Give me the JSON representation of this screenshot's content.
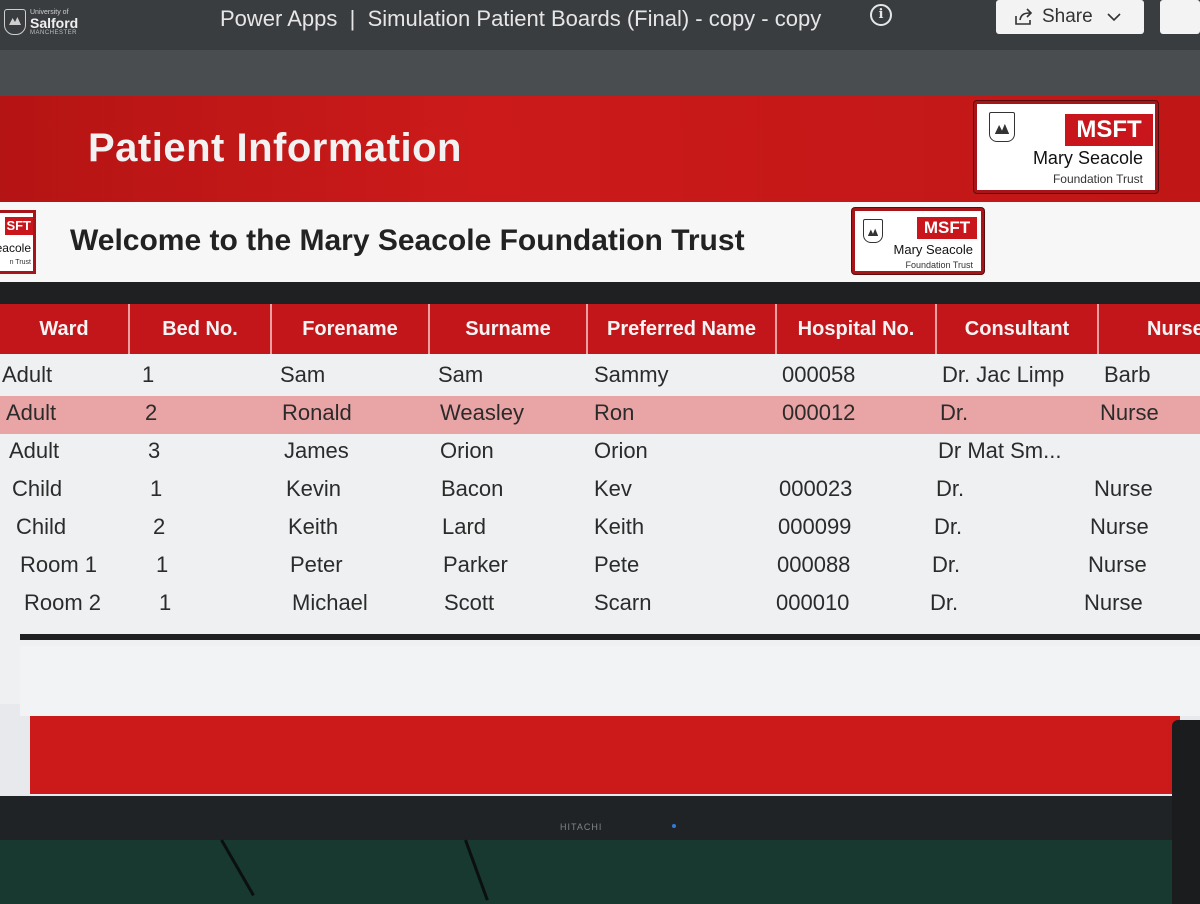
{
  "titlebar": {
    "university": {
      "small": "University of",
      "name": "Salford",
      "sub": "MANCHESTER"
    },
    "app_title": "Power Apps  |  Simulation Patient Boards (Final) - copy - copy",
    "info_icon": "i",
    "share_label": "Share"
  },
  "header": {
    "title": "Patient Information",
    "logo": {
      "abbrev": "MSFT",
      "name": "Mary Seacole",
      "trust": "Foundation Trust"
    }
  },
  "welcome": {
    "text": "Welcome to the Mary Seacole Foundation Trust",
    "partial_logo": {
      "abbrev": "SFT",
      "name": "eacole",
      "trust": "n Trust"
    },
    "logo": {
      "abbrev": "MSFT",
      "name": "Mary Seacole",
      "trust": "Foundation Trust"
    }
  },
  "table": {
    "columns": [
      "Ward",
      "Bed No.",
      "Forename",
      "Surname",
      "Preferred Name",
      "Hospital No.",
      "Consultant",
      "Nurse"
    ],
    "rows": [
      {
        "ward": "Adult",
        "bed": "1",
        "forename": "Sam",
        "surname": "Sam",
        "preferred": "Sammy",
        "hospital": "000058",
        "consultant": "Dr. Jac Limp",
        "nurse": "Barb"
      },
      {
        "ward": "Adult",
        "bed": "2",
        "forename": "Ronald",
        "surname": "Weasley",
        "preferred": "Ron",
        "hospital": "000012",
        "consultant": "Dr.",
        "nurse": "Nurse"
      },
      {
        "ward": "Adult",
        "bed": "3",
        "forename": "James",
        "surname": "Orion",
        "preferred": "Orion",
        "hospital": "",
        "consultant": "Dr Mat Sm...",
        "nurse": ""
      },
      {
        "ward": "Child",
        "bed": "1",
        "forename": "Kevin",
        "surname": "Bacon",
        "preferred": "Kev",
        "hospital": "000023",
        "consultant": "Dr.",
        "nurse": "Nurse"
      },
      {
        "ward": "Child",
        "bed": "2",
        "forename": "Keith",
        "surname": "Lard",
        "preferred": "Keith",
        "hospital": "000099",
        "consultant": "Dr.",
        "nurse": "Nurse"
      },
      {
        "ward": "Room 1",
        "bed": "1",
        "forename": "Peter",
        "surname": "Parker",
        "preferred": "Pete",
        "hospital": "000088",
        "consultant": "Dr.",
        "nurse": "Nurse"
      },
      {
        "ward": "Room 2",
        "bed": "1",
        "forename": "Michael",
        "surname": "Scott",
        "preferred": "Scarn",
        "hospital": "000010",
        "consultant": "Dr.",
        "nurse": "Nurse"
      }
    ]
  },
  "monitor": {
    "brand": "HITACHI"
  },
  "colors": {
    "primary_red": "#c8161c",
    "selected_row": "#e9a4a5",
    "titlebar": "#3a3d40"
  }
}
